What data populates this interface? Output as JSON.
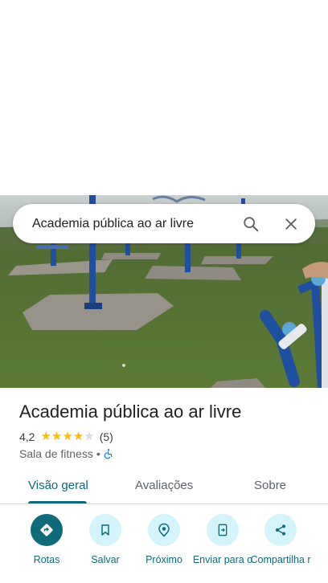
{
  "search": {
    "query": "Academia pública ao ar livre"
  },
  "place": {
    "title": "Academia pública ao ar livre",
    "rating": "4,2",
    "rating_value": 4.2,
    "review_count": "(5)",
    "category": "Sala de fitness",
    "separator": "•"
  },
  "tabs": [
    {
      "label": "Visão geral",
      "active": true
    },
    {
      "label": "Avaliações",
      "active": false
    },
    {
      "label": "Sobre",
      "active": false
    }
  ],
  "actions": [
    {
      "label": "Rotas",
      "icon": "directions-icon"
    },
    {
      "label": "Salvar",
      "icon": "bookmark-icon"
    },
    {
      "label": "Próximo",
      "icon": "nearby-icon"
    },
    {
      "label": "Enviar para o",
      "icon": "send-to-phone-icon"
    },
    {
      "label": "Compartilha r",
      "icon": "share-icon"
    }
  ],
  "colors": {
    "accent": "#0f6b7a",
    "accent_light": "#d3f4fa",
    "star": "#fbbc04",
    "wheelchair": "#1a73e8"
  }
}
